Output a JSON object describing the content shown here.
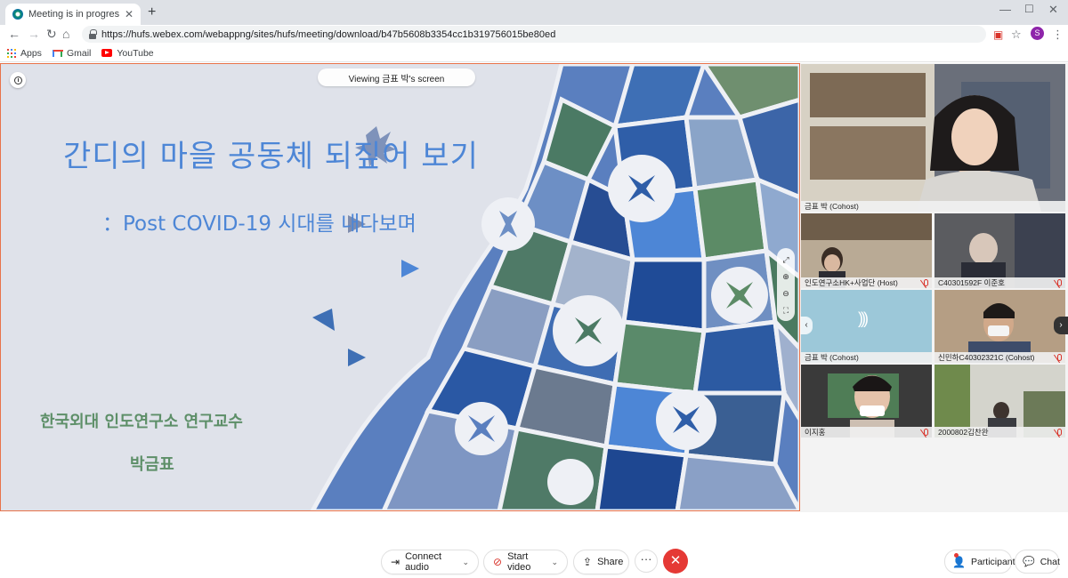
{
  "browser": {
    "tab_title": "Meeting is in progress...",
    "url": "https://hufs.webex.com/webappng/sites/hufs/meeting/download/b47b5608b3354cc1b319756015be80ed",
    "profile_initial": "S",
    "bookmarks": [
      {
        "label": "Apps",
        "icon": "apps-grid-icon"
      },
      {
        "label": "Gmail",
        "icon": "gmail-icon"
      },
      {
        "label": "YouTube",
        "icon": "youtube-icon"
      }
    ]
  },
  "share": {
    "viewing_label": "Viewing 금표 박's screen",
    "slide": {
      "title": "간디의 마을 공동체 되짚어 보기",
      "subtitle": "：Post COVID-19 시대를 내다보며",
      "author_line": "한국외대 인도연구소 연구교수",
      "author_name": "박금표"
    }
  },
  "participants": [
    {
      "name": "금표 박 (Cohost)",
      "muted": false
    },
    {
      "name": "인도연구소HK+사업단 (Host)",
      "muted": true
    },
    {
      "name": "C40301592F 이준호",
      "muted": true
    },
    {
      "name": "금표 박 (Cohost)",
      "muted": false,
      "audio_only": true
    },
    {
      "name": "신민하C40302321C (Cohost)",
      "muted": true
    },
    {
      "name": "이지홍",
      "muted": true
    },
    {
      "name": "2000802김찬완",
      "muted": true
    }
  ],
  "controls": {
    "connect_audio": "Connect audio",
    "start_video": "Start video",
    "share": "Share",
    "more": "···",
    "end": "✕",
    "participants": "Participants",
    "chat": "Chat"
  },
  "colors": {
    "accent_red": "#e53935",
    "slide_blue": "#4d86d6",
    "slide_green": "#5d8f68",
    "stage_border": "#e8734a"
  }
}
